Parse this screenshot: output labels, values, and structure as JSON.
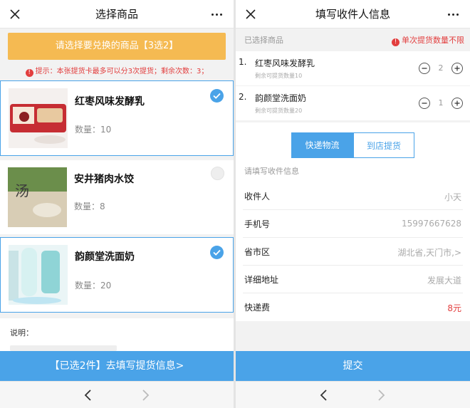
{
  "left": {
    "title": "选择商品",
    "banner": "请选择要兑换的商品【3选2】",
    "tip": "提示：本张提货卡最多可以分3次提货；剩余次数：3；",
    "tip_icon": "!",
    "products": [
      {
        "name": "红枣风味发酵乳",
        "qty": "数量：10",
        "selected": true
      },
      {
        "name": "安井猪肉水饺",
        "qty": "数量：8",
        "selected": false
      },
      {
        "name": "韵颜堂洗面奶",
        "qty": "数量：20",
        "selected": true
      }
    ],
    "note_label": "说明：",
    "submit": "【已选2件】去填写提货信息>"
  },
  "right": {
    "title": "填写收件人信息",
    "selected_label": "已选择商品",
    "limit": "单次提货数量不限",
    "limit_icon": "!",
    "items": [
      {
        "num": "1.",
        "name": "红枣风味发酵乳",
        "remain": "剩余可提货数量10",
        "count": "2"
      },
      {
        "num": "2.",
        "name": "韵颜堂洗面奶",
        "remain": "剩余可提货数量20",
        "count": "1"
      }
    ],
    "tabs": [
      "快递物流",
      "到店提货"
    ],
    "form_hint": "请填写收件信息",
    "fields": [
      {
        "label": "收件人",
        "value": "小天"
      },
      {
        "label": "手机号",
        "value": "15997667628"
      },
      {
        "label": "省市区",
        "value": "湖北省,天门市,>"
      },
      {
        "label": "详细地址",
        "value": "发展大道"
      },
      {
        "label": "快递费",
        "value": "8元"
      }
    ],
    "submit": "提交"
  },
  "colors": {
    "accent": "#4aa3e8",
    "banner": "#f5ba52",
    "warn": "#e23e3e"
  },
  "icons": [
    "close-icon",
    "more-icon",
    "check-icon",
    "minus-icon",
    "plus-icon",
    "back-arrow-icon",
    "forward-arrow-icon"
  ]
}
